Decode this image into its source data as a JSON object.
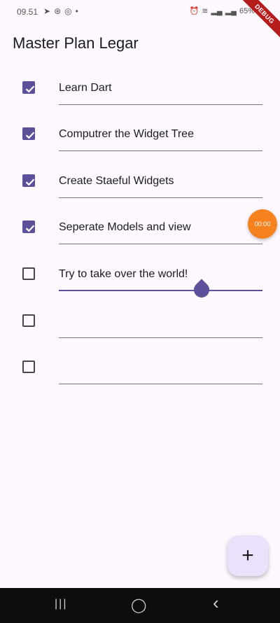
{
  "status_bar": {
    "time": "09.51",
    "left_icons": [
      "telegram-icon",
      "sync-icon",
      "instagram-icon",
      "dot-icon"
    ],
    "right_icons": [
      "alarm-icon",
      "wifi-icon",
      "signal-icon",
      "signal-icon-2"
    ],
    "battery": "65%",
    "debug_label": "DEBUG"
  },
  "app": {
    "title": "Master Plan Legar"
  },
  "tasks": [
    {
      "text": "Learn Dart",
      "checked": true
    },
    {
      "text": "Computrer the Widget Tree",
      "checked": true
    },
    {
      "text": "Create Staeful Widgets",
      "checked": true
    },
    {
      "text": "Seperate Models and view",
      "checked": true
    },
    {
      "text": "Try to take over the world!",
      "checked": false,
      "focused": true
    },
    {
      "text": "",
      "checked": false
    },
    {
      "text": "",
      "checked": false
    }
  ],
  "overlay_bubble": {
    "label": "00:00"
  },
  "fab": {
    "label": "+"
  },
  "nav": {
    "recents": "|||",
    "home": "◯",
    "back": "‹"
  },
  "colors": {
    "accent": "#5d4f99",
    "background": "#fdf8fd",
    "fab_bg": "#eae1fb",
    "bubble": "#f5821f",
    "debug": "#b71c1c"
  }
}
